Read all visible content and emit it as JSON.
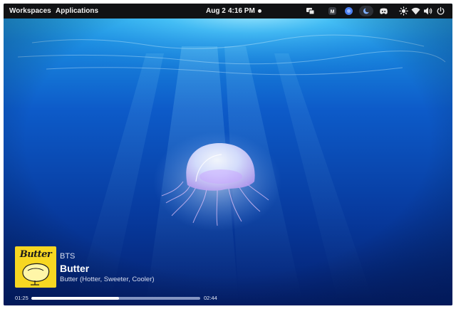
{
  "panel": {
    "workspaces": "Workspaces",
    "applications": "Applications",
    "date": "Aug 2",
    "time": "4:16 PM",
    "tray_icons": [
      "display-icon",
      "m-app-icon",
      "blue-circle-app-icon",
      "night-mode-icon",
      "discord-icon",
      "brightness-icon",
      "wifi-icon",
      "volume-icon",
      "power-icon"
    ]
  },
  "media": {
    "album_art_text": "Butter",
    "artist": "BTS",
    "title": "Butter",
    "album": "Butter (Hotter, Sweeter, Cooler)",
    "elapsed": "01:25",
    "total": "02:44",
    "progress": 0.52
  },
  "colors": {
    "panel_bg": "#111214",
    "accent_blue": "#4a7ff0",
    "album_yellow": "#f7d722",
    "water_deep": "#03186b"
  }
}
